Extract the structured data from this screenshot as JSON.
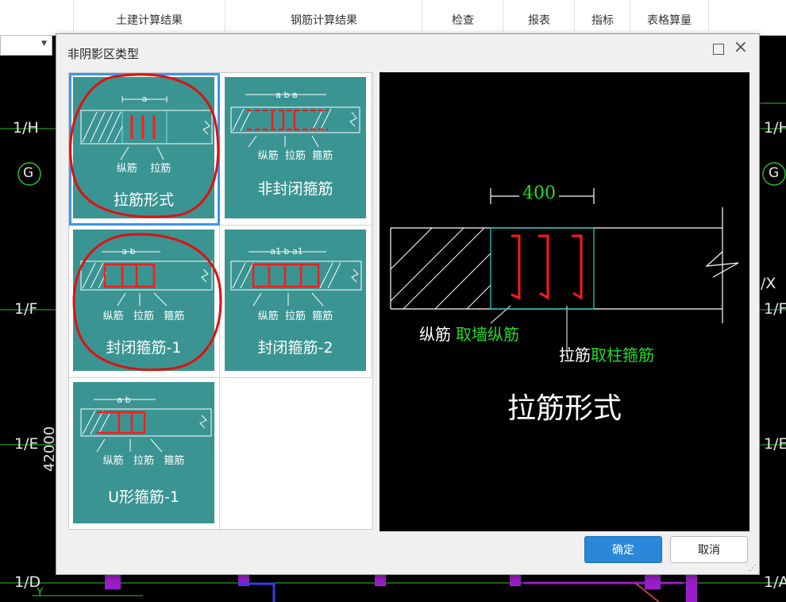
{
  "ribbon": {
    "tabs": [
      "土建计算结果",
      "钢筋计算结果",
      "检查",
      "报表",
      "指标",
      "表格算量"
    ]
  },
  "cad": {
    "axis_labels_left": [
      "1/H",
      "G",
      "1/F",
      "1/E",
      "1/D"
    ],
    "axis_labels_right": [
      "1/H",
      "G",
      "1/F",
      "1/E",
      "1/A"
    ],
    "x_label": "/X",
    "y_label": "Y",
    "dimension": "42000"
  },
  "dialog": {
    "title": "非阴影区类型",
    "options": [
      {
        "caption": "拉筋形式",
        "labels": [
          "纵筋",
          "拉筋"
        ],
        "dims": "a",
        "selected": true
      },
      {
        "caption": "非封闭箍筋",
        "labels": [
          "纵筋",
          "拉筋",
          "箍筋"
        ],
        "dims": "a b a",
        "selected": false
      },
      {
        "caption": "封闭箍筋-1",
        "labels": [
          "纵筋",
          "拉筋",
          "箍筋"
        ],
        "dims": "a b",
        "selected": false
      },
      {
        "caption": "封闭箍筋-2",
        "labels": [
          "纵筋",
          "拉筋",
          "箍筋"
        ],
        "dims": "a1 b a1",
        "selected": false
      },
      {
        "caption": "U形箍筋-1",
        "labels": [
          "纵筋",
          "拉筋",
          "箍筋"
        ],
        "dims": "a b",
        "selected": false
      }
    ],
    "preview": {
      "dimension": "400",
      "label_long": "纵筋",
      "label_long_note": "取墙纵筋",
      "label_tie": "拉筋",
      "label_tie_note": "取柱箍筋",
      "caption": "拉筋形式"
    },
    "ok_label": "确定",
    "cancel_label": "取消"
  },
  "colors": {
    "card": "#3a9492",
    "selection": "#3a96f0",
    "rebar": "#ff1a1a",
    "note_green": "#22dd22",
    "annotation_circle": "#e01010"
  }
}
